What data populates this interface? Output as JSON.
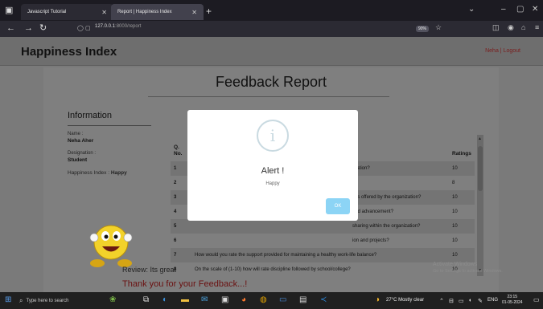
{
  "browser": {
    "tabs": [
      {
        "label": "Javascript Tutorial",
        "close": "✕"
      },
      {
        "label": "Report | Happiness Index",
        "close": "✕"
      }
    ],
    "new_tab": "+",
    "url_host": "127.0.0.1",
    "url_path": ":8000/report",
    "zoom": "90%"
  },
  "header": {
    "title": "Happiness Index",
    "user_name": "Neha",
    "separator": "|",
    "logout": "Logout"
  },
  "report": {
    "title": "Feedback Report",
    "info_title": "Information",
    "name_label": "Name :",
    "name_value": "Neha Aher",
    "designation_label": "Designation :",
    "designation_value": "Student",
    "happiness_label": "Happiness Index : ",
    "happiness_value": "Happy",
    "col_q": "Q.",
    "col_no": "No.",
    "col_ratings": "Ratings",
    "rows": [
      {
        "no": "1",
        "question": "bration?",
        "rating": "10"
      },
      {
        "no": "2",
        "question": "e?",
        "rating": "8"
      },
      {
        "no": "3",
        "question": "ties offered by the organization?",
        "rating": "10"
      },
      {
        "no": "4",
        "question": "and advancement?",
        "rating": "10"
      },
      {
        "no": "5",
        "question": "sharing within the organization?",
        "rating": "10"
      },
      {
        "no": "6",
        "question": "ion and projects?",
        "rating": "10"
      },
      {
        "no": "7",
        "question": "How would you rate the support provided for maintaining a healthy work-life balance?",
        "rating": "10"
      },
      {
        "no": "8",
        "question": "On the scale of (1-10) how will rate discipline followed by school/college?",
        "rating": "10"
      }
    ],
    "review_label": "Review: ",
    "review_value": "Its great",
    "thanks": "Thank you for your Feedback...!"
  },
  "modal": {
    "icon": "i",
    "title": "Alert !",
    "text": "Happy",
    "ok": "OK"
  },
  "watermark": {
    "line1": "Activate Windows",
    "line2": "Go to Settings to activate Windows."
  },
  "taskbar": {
    "search_placeholder": "Type here to search",
    "weather": "27°C  Mostly clear",
    "lang": "ENG",
    "time": "23:15",
    "date": "01-05-2024"
  }
}
